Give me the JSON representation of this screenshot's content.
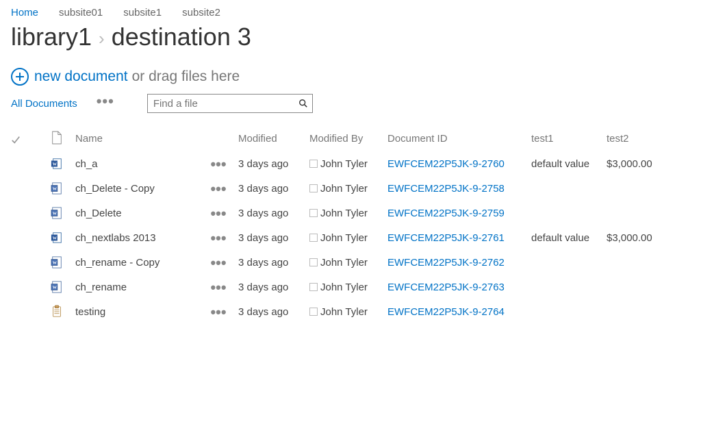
{
  "nav": {
    "items": [
      "Home",
      "subsite01",
      "subsite1",
      "subsite2"
    ],
    "active_index": 0
  },
  "breadcrumb": {
    "part1": "library1",
    "part2": "destination 3"
  },
  "actions": {
    "new_document": "new document",
    "drag_hint": "or drag files here",
    "all_documents": "All Documents",
    "search_placeholder": "Find a file"
  },
  "columns": {
    "name": "Name",
    "modified": "Modified",
    "modified_by": "Modified By",
    "doc_id": "Document ID",
    "test1": "test1",
    "test2": "test2"
  },
  "rows": [
    {
      "icon": "docx",
      "name": "ch_a",
      "modified": "3 days ago",
      "modified_by": "John Tyler",
      "doc_id": "EWFCEM22P5JK-9-2760",
      "test1": "default value",
      "test2": "$3,000.00"
    },
    {
      "icon": "doc",
      "name": "ch_Delete - Copy",
      "modified": "3 days ago",
      "modified_by": "John Tyler",
      "doc_id": "EWFCEM22P5JK-9-2758",
      "test1": "",
      "test2": ""
    },
    {
      "icon": "doc",
      "name": "ch_Delete",
      "modified": "3 days ago",
      "modified_by": "John Tyler",
      "doc_id": "EWFCEM22P5JK-9-2759",
      "test1": "",
      "test2": ""
    },
    {
      "icon": "docx",
      "name": "ch_nextlabs 2013",
      "modified": "3 days ago",
      "modified_by": "John Tyler",
      "doc_id": "EWFCEM22P5JK-9-2761",
      "test1": "default value",
      "test2": "$3,000.00"
    },
    {
      "icon": "doc",
      "name": "ch_rename - Copy",
      "modified": "3 days ago",
      "modified_by": "John Tyler",
      "doc_id": "EWFCEM22P5JK-9-2762",
      "test1": "",
      "test2": ""
    },
    {
      "icon": "doc",
      "name": "ch_rename",
      "modified": "3 days ago",
      "modified_by": "John Tyler",
      "doc_id": "EWFCEM22P5JK-9-2763",
      "test1": "",
      "test2": ""
    },
    {
      "icon": "note",
      "name": "testing",
      "modified": "3 days ago",
      "modified_by": "John Tyler",
      "doc_id": "EWFCEM22P5JK-9-2764",
      "test1": "",
      "test2": ""
    }
  ]
}
